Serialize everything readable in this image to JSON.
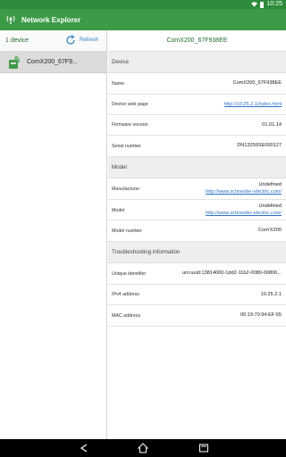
{
  "status_bar": {
    "time": "10:25"
  },
  "app": {
    "title": "Network Explorer"
  },
  "left": {
    "device_count": "1 device",
    "refresh_label": "Refresh",
    "devices": [
      {
        "label": "ComX200_67F9..."
      }
    ]
  },
  "detail": {
    "title": "ComX200_67F938EE",
    "sections": {
      "device": "Device",
      "model": "Model",
      "troubleshooting": "Troubleshooting information"
    },
    "device_rows": {
      "name": {
        "label": "Name",
        "value": "ComX200_67F938EE"
      },
      "web_page": {
        "label": "Device web page",
        "value": "http://10.25.2.1/index.html"
      },
      "firmware": {
        "label": "Firmware version",
        "value": "01.01.14"
      },
      "serial": {
        "label": "Serial number",
        "value": "DN13259SE000127"
      }
    },
    "model_rows": {
      "manufacturer": {
        "label": "Manufacturer",
        "value": "Undefined",
        "link": "http://www.schneider-electric.com/"
      },
      "model": {
        "label": "Model",
        "value": "Undefined",
        "link": "http://www.schneider-electric.com/"
      },
      "model_number": {
        "label": "Model number",
        "value": "Com'X200"
      }
    },
    "troubleshooting_rows": {
      "uid": {
        "label": "Unique identifier",
        "value": "urn:uuid:13814000-1dd2-11b2-0080-00806..."
      },
      "ipv4": {
        "label": "IPv4 address",
        "value": "10.25.2.1"
      },
      "mac": {
        "label": "MAC address",
        "value": "00:19:70:94:EF:65"
      }
    }
  },
  "colors": {
    "actionbar": "#3d9a47",
    "statusbar": "#2e8b3c",
    "link": "#2d6fc7",
    "selected": "#dcdcdc"
  },
  "icons": [
    "wifi-icon",
    "battery-icon",
    "network-explorer-app-icon",
    "refresh-icon",
    "device-icon",
    "back-icon",
    "home-icon",
    "recents-icon"
  ]
}
